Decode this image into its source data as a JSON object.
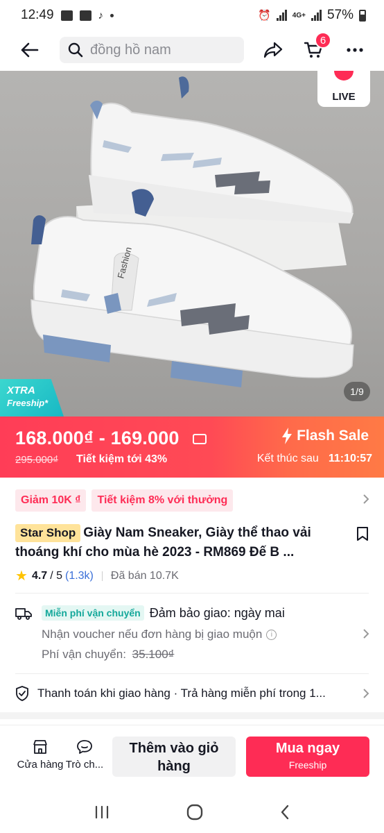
{
  "status_bar": {
    "time": "12:49",
    "battery": "57%",
    "network": "4G+"
  },
  "search": {
    "placeholder": "đồng hồ nam"
  },
  "cart": {
    "badge": "6"
  },
  "hero": {
    "live_label": "LIVE",
    "xtra_line1": "XTRA",
    "xtra_line2": "Freeship*",
    "pager": "1/9"
  },
  "flash": {
    "price_range": "168.000₫ - 169.000",
    "original_price": "295.000₫",
    "savings": "Tiết kiệm tới 43%",
    "label": "Flash Sale",
    "ends_label": "Kết thúc sau",
    "countdown": "11:10:57"
  },
  "promos": [
    "Giảm 10K ₫",
    "Tiết kiệm 8% với thưởng"
  ],
  "product": {
    "shop_tag": "Star Shop",
    "title": "Giày Nam Sneaker, Giày thể thao vải thoáng khí cho mùa hè 2023 - RM869 Đế B ...",
    "rating": "4.7",
    "rating_max": "/ 5",
    "rating_count": "(1.3k)",
    "sold": "Đã bán 10.7K"
  },
  "shipping": {
    "tag": "Miễn phí vận chuyển",
    "guarantee": "Đảm bảo giao: ngày mai",
    "voucher_note": "Nhận voucher nếu đơn hàng bị giao muộn",
    "fee_label": "Phí vận chuyển:",
    "fee_old": "35.100₫"
  },
  "payment": {
    "text": "Thanh toán khi giao hàng · Trả hàng miễn phí trong 1..."
  },
  "actions": {
    "shop_label": "Cửa hàng",
    "chat_label": "Trò ch...",
    "add_to_cart": "Thêm vào giỏ hàng",
    "buy_now": "Mua ngay",
    "buy_sub": "Freeship"
  },
  "colors": {
    "accent": "#fe2c55",
    "shop_tag": "#ffe39a",
    "freeship": "#14a89a"
  }
}
